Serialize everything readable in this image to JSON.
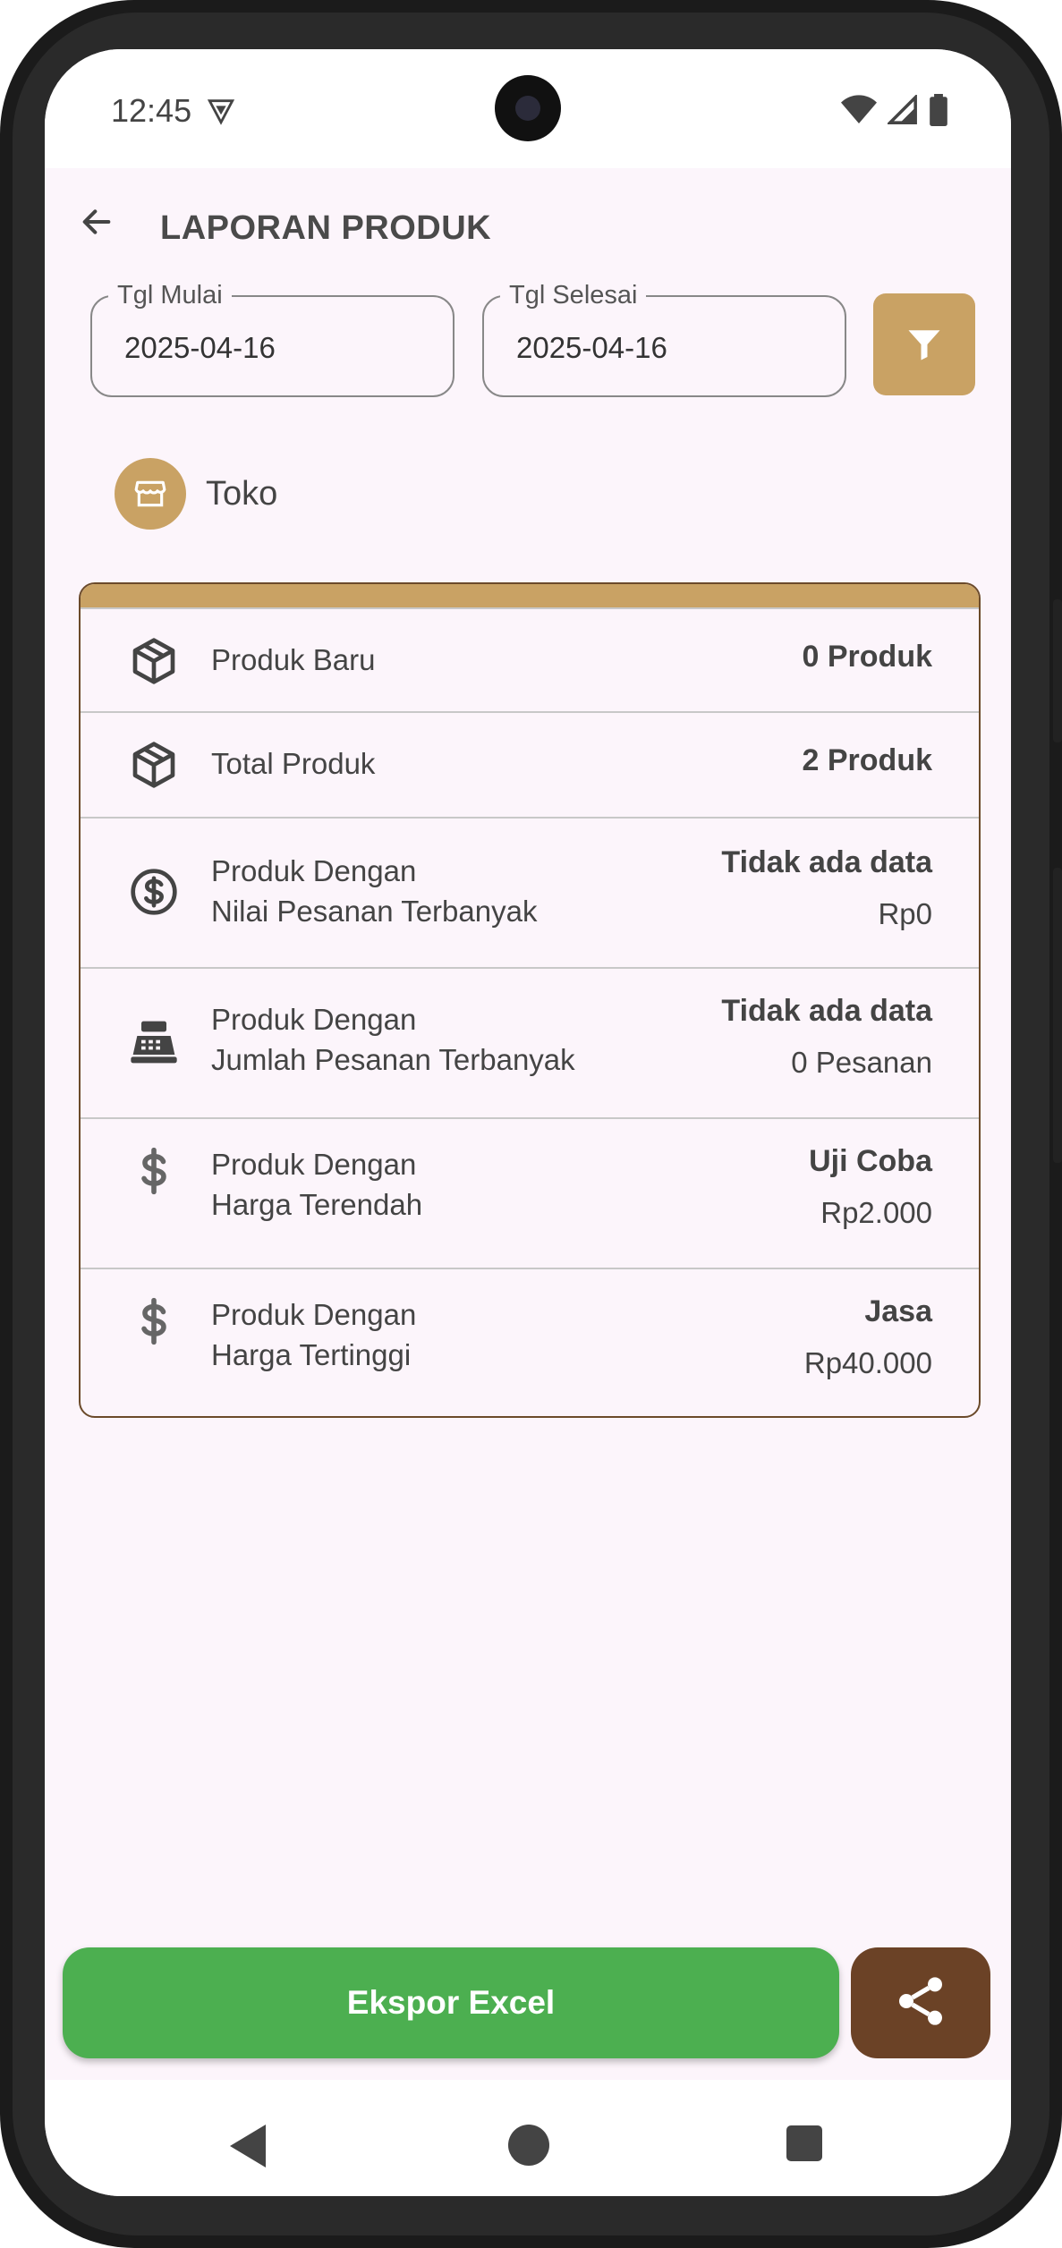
{
  "status_bar": {
    "time": "12:45"
  },
  "header": {
    "title": "LAPORAN PRODUK"
  },
  "filter": {
    "start_label": "Tgl Mulai",
    "start_value": "2025-04-16",
    "end_label": "Tgl Selesai",
    "end_value": "2025-04-16"
  },
  "store": {
    "label": "Toko"
  },
  "report_rows": [
    {
      "icon": "box-icon",
      "label_line1": "Produk Baru",
      "label_line2": "",
      "value": "0 Produk",
      "subvalue": ""
    },
    {
      "icon": "box-icon",
      "label_line1": "Total Produk",
      "label_line2": "",
      "value": "2 Produk",
      "subvalue": ""
    },
    {
      "icon": "dollar-circle-icon",
      "label_line1": "Produk Dengan",
      "label_line2": "Nilai Pesanan Terbanyak",
      "value": "Tidak ada data",
      "subvalue": "Rp0"
    },
    {
      "icon": "cash-register-icon",
      "label_line1": "Produk Dengan",
      "label_line2": "Jumlah Pesanan Terbanyak",
      "value": "Tidak ada data",
      "subvalue": "0 Pesanan"
    },
    {
      "icon": "dollar-icon",
      "label_line1": "Produk Dengan",
      "label_line2": "Harga Terendah",
      "value": "Uji Coba",
      "subvalue": "Rp2.000"
    },
    {
      "icon": "dollar-icon",
      "label_line1": "Produk Dengan",
      "label_line2": "Harga Tertinggi",
      "value": "Jasa",
      "subvalue": "Rp40.000"
    }
  ],
  "actions": {
    "export_label": "Ekspor Excel"
  },
  "colors": {
    "accent": "#c9a264",
    "export": "#4caf50",
    "share": "#6b4226",
    "background": "#fcf5fb"
  }
}
